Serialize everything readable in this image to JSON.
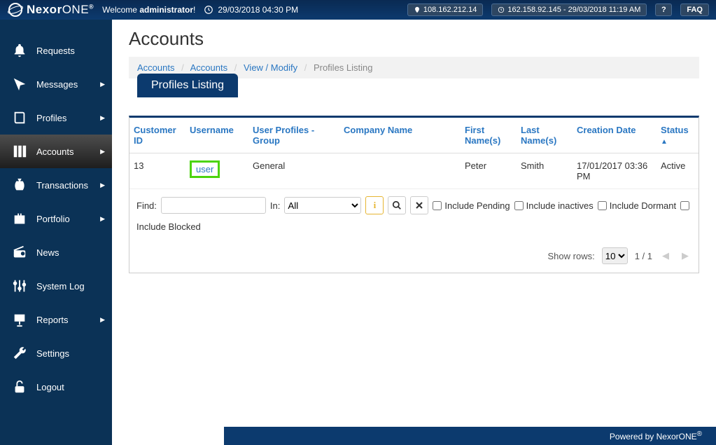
{
  "header": {
    "logo_text_a": "Nexor",
    "logo_text_b": "ONE",
    "logo_reg": "®",
    "welcome_prefix": "Welcome ",
    "welcome_user": "administrator",
    "welcome_suffix": "!",
    "datetime": "29/03/2018 04:30 PM",
    "ip": "108.162.212.14",
    "last_login": "162.158.92.145 - 29/03/2018 11:19 AM",
    "help": "?",
    "faq": "FAQ"
  },
  "sidebar": {
    "items": [
      {
        "label": "Requests",
        "expandable": false
      },
      {
        "label": "Messages",
        "expandable": true
      },
      {
        "label": "Profiles",
        "expandable": true
      },
      {
        "label": "Accounts",
        "expandable": true
      },
      {
        "label": "Transactions",
        "expandable": true
      },
      {
        "label": "Portfolio",
        "expandable": true
      },
      {
        "label": "News",
        "expandable": false
      },
      {
        "label": "System Log",
        "expandable": false
      },
      {
        "label": "Reports",
        "expandable": true
      },
      {
        "label": "Settings",
        "expandable": false
      },
      {
        "label": "Logout",
        "expandable": false
      }
    ]
  },
  "main": {
    "title": "Accounts",
    "breadcrumb": {
      "a": "Accounts",
      "b": "Accounts",
      "c": "View / Modify",
      "d": "Profiles Listing"
    },
    "tab_label": "Profiles Listing",
    "columns": {
      "customer_id": "Customer ID",
      "username": "Username",
      "group": "User Profiles - Group",
      "company": "Company Name",
      "first": "First Name(s)",
      "last": "Last Name(s)",
      "created": "Creation Date",
      "status": "Status"
    },
    "rows": [
      {
        "customer_id": "13",
        "username": "user",
        "group": "General",
        "company": "",
        "first": "Peter",
        "last": "Smith",
        "created": "17/01/2017 03:36 PM",
        "status": "Active"
      }
    ],
    "filters": {
      "find_label": "Find:",
      "in_label": "In:",
      "in_value": "All",
      "info": "i",
      "include_pending": "Include Pending",
      "include_inactives": "Include inactives",
      "include_dormant": "Include Dormant",
      "include_blocked": "Include Blocked"
    },
    "pager": {
      "show_rows": "Show rows:",
      "rows_value": "10",
      "page_text": "1 / 1"
    }
  },
  "footer": {
    "text": "Powered by NexorONE",
    "reg": "®"
  }
}
